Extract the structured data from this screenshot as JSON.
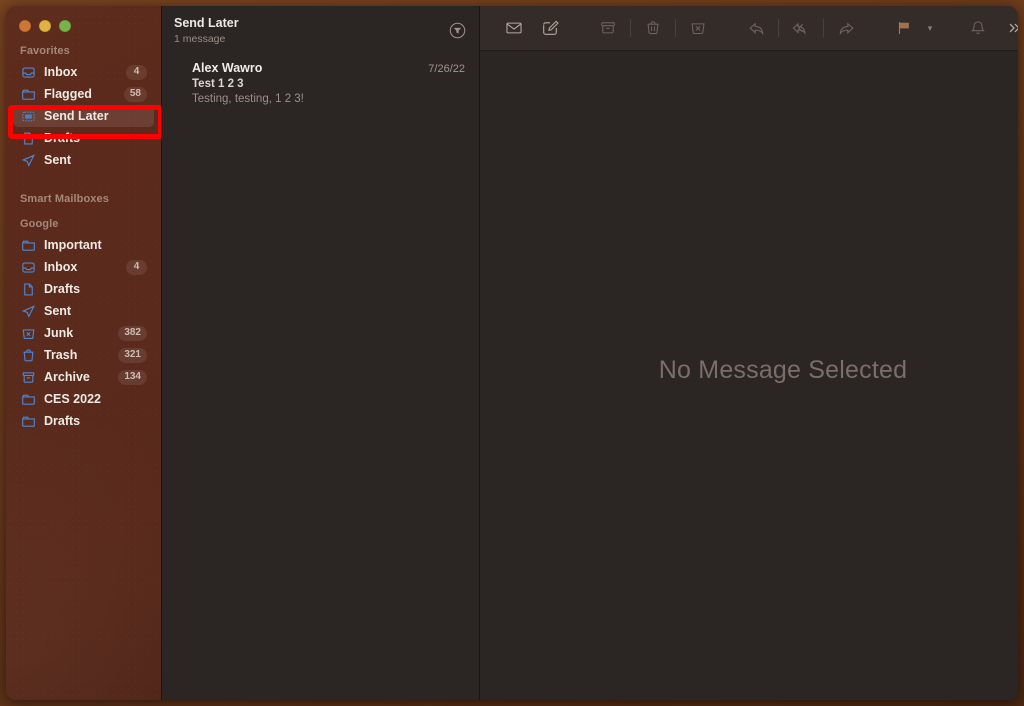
{
  "window": {
    "traffic_lights": [
      "close",
      "minimize",
      "maximize"
    ]
  },
  "sidebar": {
    "sections": [
      {
        "title": "Favorites",
        "items": [
          {
            "label": "Inbox",
            "icon": "inbox-icon",
            "badge": "4",
            "selected": false
          },
          {
            "label": "Flagged",
            "icon": "folder-icon",
            "badge": "58",
            "selected": false
          },
          {
            "label": "Send Later",
            "icon": "send-later-icon",
            "badge": "",
            "selected": true
          },
          {
            "label": "Drafts",
            "icon": "drafts-icon",
            "badge": "",
            "selected": false
          },
          {
            "label": "Sent",
            "icon": "sent-icon",
            "badge": "",
            "selected": false
          }
        ]
      },
      {
        "title": "Smart Mailboxes",
        "items": []
      },
      {
        "title": "Google",
        "items": [
          {
            "label": "Important",
            "icon": "folder-icon",
            "badge": "",
            "selected": false
          },
          {
            "label": "Inbox",
            "icon": "inbox-icon",
            "badge": "4",
            "selected": false
          },
          {
            "label": "Drafts",
            "icon": "drafts-icon",
            "badge": "",
            "selected": false
          },
          {
            "label": "Sent",
            "icon": "sent-icon",
            "badge": "",
            "selected": false
          },
          {
            "label": "Junk",
            "icon": "junk-icon",
            "badge": "382",
            "selected": false
          },
          {
            "label": "Trash",
            "icon": "trash-icon",
            "badge": "321",
            "selected": false
          },
          {
            "label": "Archive",
            "icon": "archive-icon",
            "badge": "134",
            "selected": false
          },
          {
            "label": "CES 2022",
            "icon": "folder-icon",
            "badge": "",
            "selected": false
          },
          {
            "label": "Drafts",
            "icon": "folder-icon",
            "badge": "",
            "selected": false
          }
        ]
      }
    ],
    "highlight": {
      "target_label": "Send Later",
      "color": "#fe0000"
    }
  },
  "message_list": {
    "mailbox_title": "Send Later",
    "message_count": "1 message",
    "filter_icon": "filter-icon",
    "messages": [
      {
        "sender": "Alex Wawro",
        "date": "7/26/22",
        "subject": "Test 1 2 3",
        "preview": "Testing, testing, 1 2 3!"
      }
    ]
  },
  "toolbar": {
    "buttons": [
      {
        "name": "get-mail-button",
        "icon": "envelope-icon",
        "state": "enabled"
      },
      {
        "name": "compose-button",
        "icon": "compose-icon",
        "state": "enabled"
      },
      {
        "name": "archive-button",
        "icon": "archive-box-icon",
        "state": "disabled"
      },
      {
        "name": "delete-button",
        "icon": "trash-icon",
        "state": "disabled"
      },
      {
        "name": "junk-button",
        "icon": "junk-bin-icon",
        "state": "disabled"
      },
      {
        "name": "reply-button",
        "icon": "reply-icon",
        "state": "disabled"
      },
      {
        "name": "reply-all-button",
        "icon": "reply-all-icon",
        "state": "disabled"
      },
      {
        "name": "forward-button",
        "icon": "forward-icon",
        "state": "disabled"
      },
      {
        "name": "flag-button",
        "icon": "flag-icon",
        "state": "enabled"
      },
      {
        "name": "mute-button",
        "icon": "bell-icon",
        "state": "disabled"
      }
    ],
    "right_buttons": [
      {
        "name": "more-toolbar-items-button",
        "icon": "chevron-double-right-icon"
      },
      {
        "name": "search-button",
        "icon": "search-icon"
      }
    ]
  },
  "reading_pane": {
    "empty_state_text": "No Message Selected"
  },
  "colors": {
    "highlight": "#fe0000",
    "accent_icon": "#4c87d6",
    "flag": "#b07a4e",
    "pane_bg": "#2b2523",
    "sidebar_bg": "#5a2b1d"
  }
}
